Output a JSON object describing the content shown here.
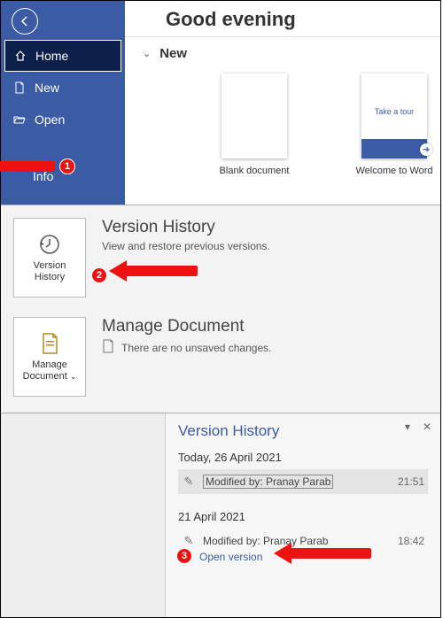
{
  "greeting": "Good evening",
  "backstage": {
    "home": "Home",
    "new": "New",
    "open": "Open",
    "info": "Info"
  },
  "start": {
    "section_label": "New",
    "templates": {
      "blank": "Blank document",
      "tour_text": "Take a tour",
      "tour_caption": "Welcome to Word"
    }
  },
  "info": {
    "version_history": {
      "card": "Version\nHistory",
      "title": "Version History",
      "desc": "View and restore previous versions."
    },
    "manage_doc": {
      "card": "Manage\nDocument",
      "title": "Manage Document",
      "desc": "There are no unsaved changes."
    }
  },
  "vh_pane": {
    "title": "Version History",
    "groups": [
      {
        "date": "Today, 26 April 2021",
        "entries": [
          {
            "by": "Modified by: Pranay Parab",
            "time": "21:51",
            "selected": true
          }
        ]
      },
      {
        "date": "21 April 2021",
        "entries": [
          {
            "by": "Modified by: Pranay Parab",
            "time": "18:42",
            "open": "Open version"
          }
        ]
      }
    ]
  },
  "annotations": {
    "b1": "1",
    "b2": "2",
    "b3": "3"
  }
}
